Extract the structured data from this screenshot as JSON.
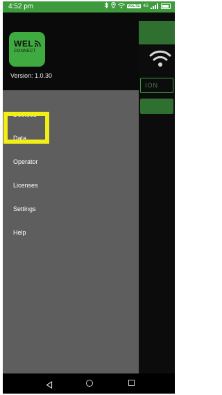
{
  "status_bar": {
    "time": "4:52 pm",
    "network_badge": "VoLTE",
    "network_type": "4G",
    "icons": [
      "bluetooth-icon",
      "location-icon",
      "wifi-icon",
      "signal-icon",
      "battery-icon"
    ]
  },
  "drawer": {
    "logo": {
      "line1": "WEL",
      "line2": "CONNECT"
    },
    "version": "Version: 1.0.30",
    "items": [
      {
        "label": "Devices",
        "bold": true
      },
      {
        "label": "Data",
        "bold": false
      },
      {
        "label": "Operator",
        "bold": false
      },
      {
        "label": "Licenses",
        "bold": false
      },
      {
        "label": "Settings",
        "bold": false
      },
      {
        "label": "Help",
        "bold": false
      }
    ]
  },
  "background_app": {
    "outline_button_fragment": "ION"
  },
  "colors": {
    "brand_green": "#3d9b3d",
    "drawer_bg": "#5e5e5e",
    "highlight": "#f2ef16"
  }
}
